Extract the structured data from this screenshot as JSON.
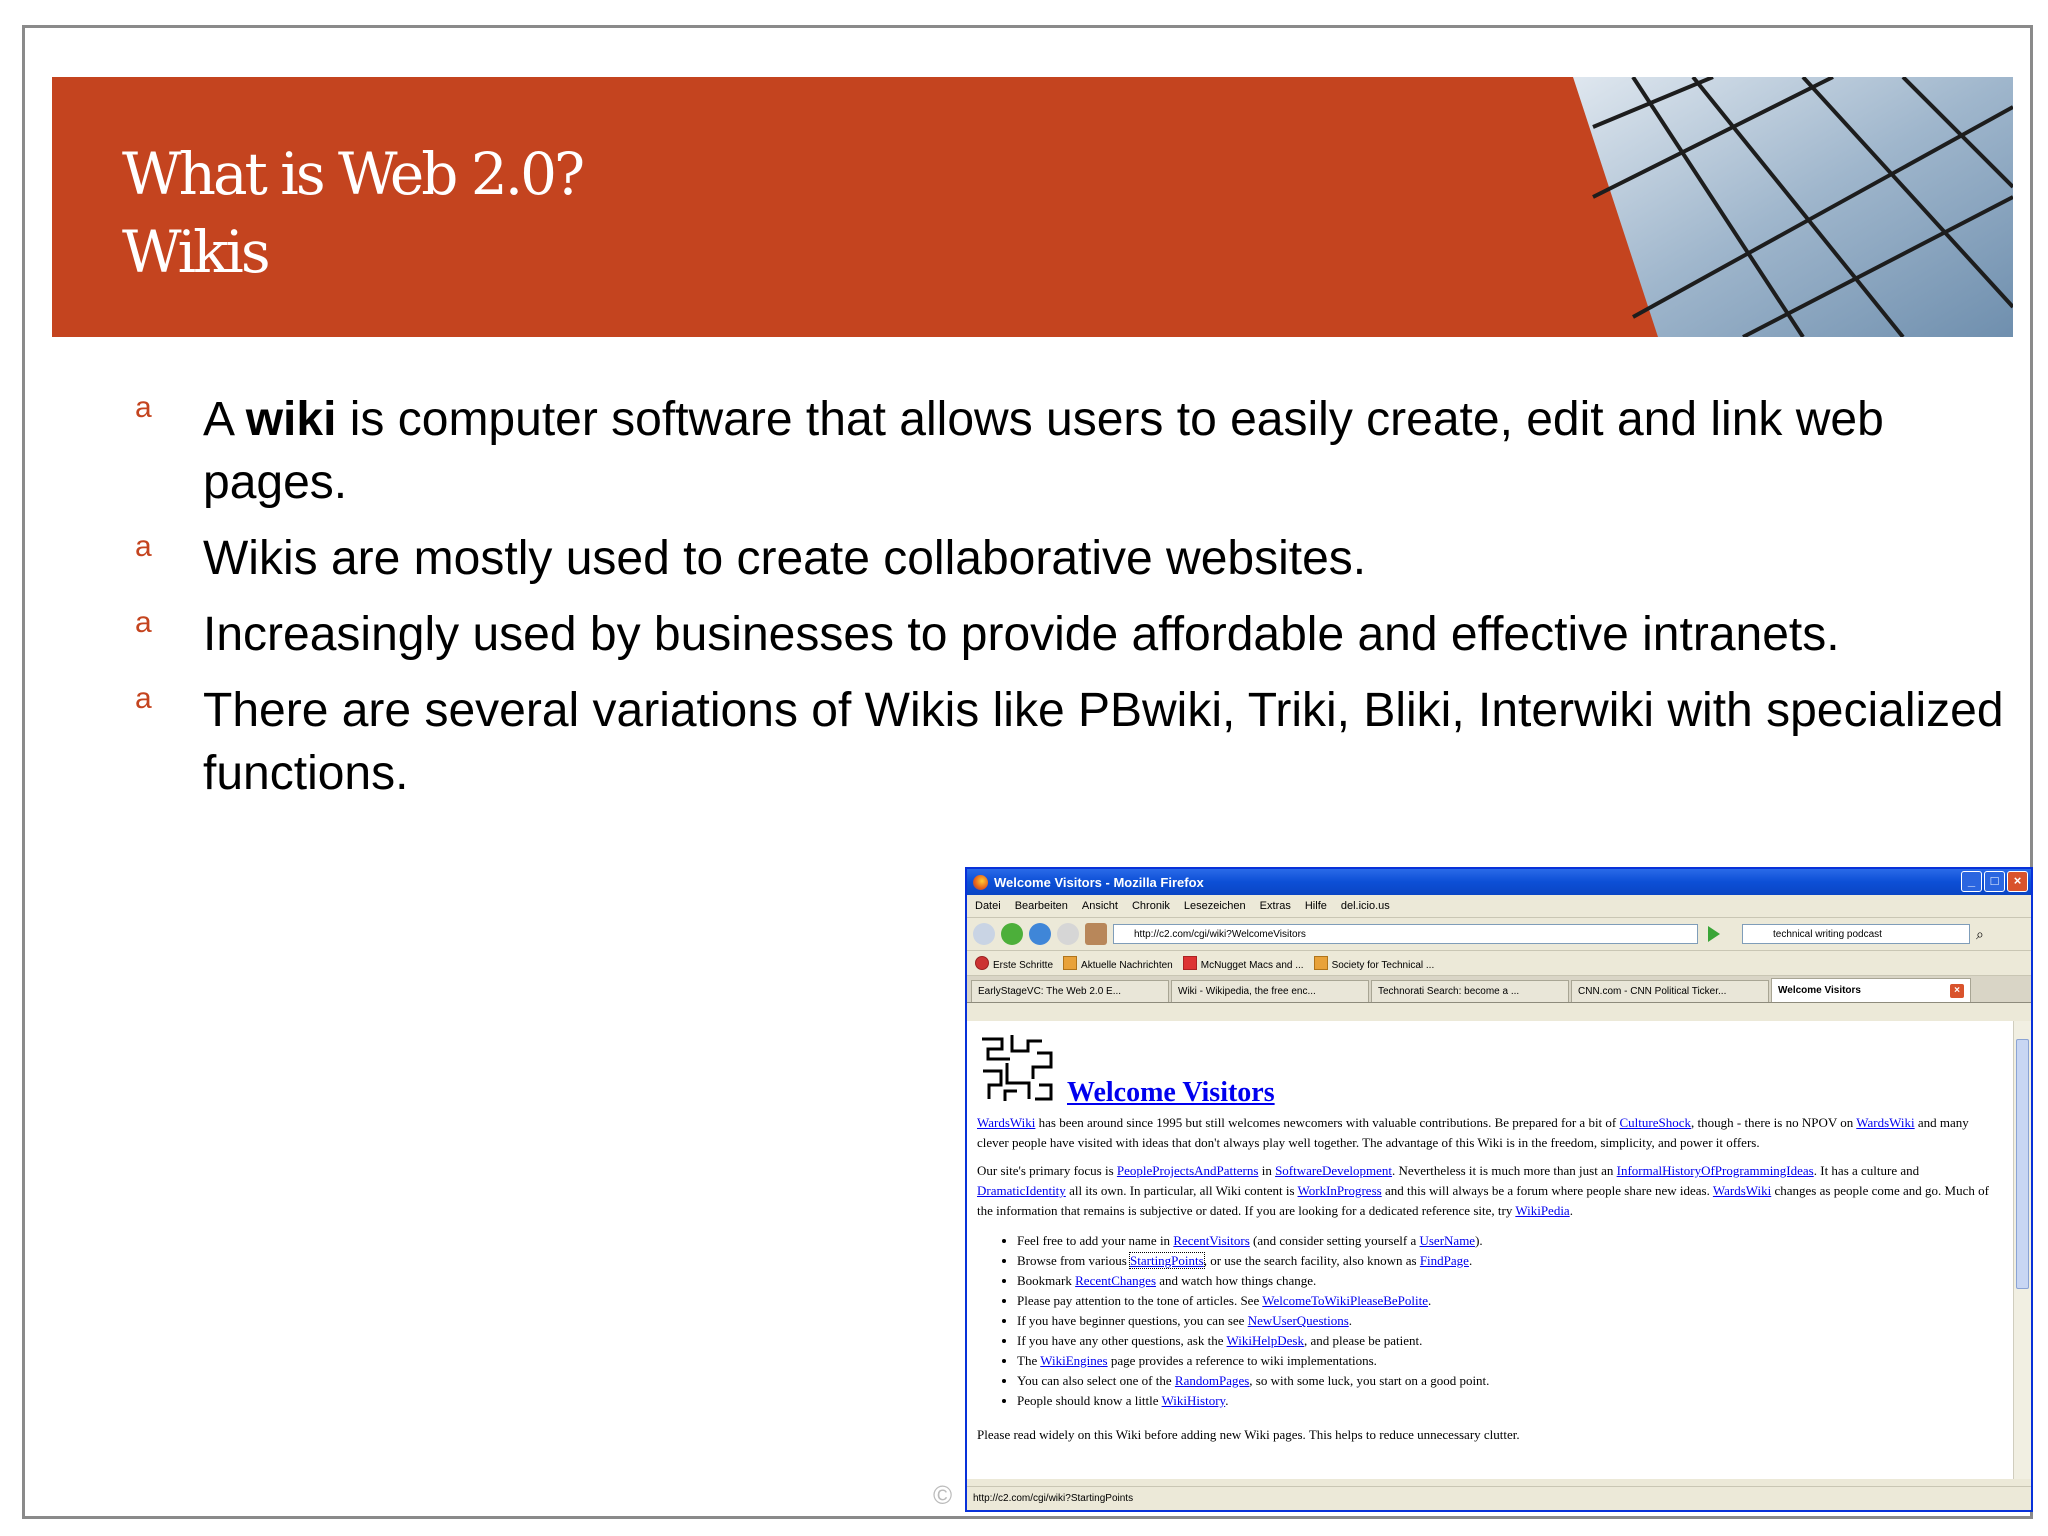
{
  "slide": {
    "title_line1": "What is Web 2.0?",
    "title_line2": "Wikis",
    "accent_color": "#c4441f",
    "bullet_marker": "a",
    "bullets": [
      {
        "pre": "A ",
        "bold": "wiki",
        "post": " is computer software that allows users to easily create, edit and link web pages."
      },
      {
        "pre": "Wikis are mostly used to create collaborative websites.",
        "bold": "",
        "post": ""
      },
      {
        "pre": "Increasingly used  by businesses to provide affordable and effective intranets.",
        "bold": "",
        "post": ""
      },
      {
        "pre": "There are several variations of Wikis like PBwiki, Triki, Bliki, Interwiki with specialized functions.",
        "bold": "",
        "post": ""
      }
    ],
    "copyright": "©"
  },
  "browser": {
    "window_title": "Welcome Visitors - Mozilla Firefox",
    "menu": [
      "Datei",
      "Bearbeiten",
      "Ansicht",
      "Chronik",
      "Lesezeichen",
      "Extras",
      "Hilfe",
      "del.icio.us"
    ],
    "url": "http://c2.com/cgi/wiki?WelcomeVisitors",
    "search_value": "technical writing podcast",
    "bookmarks": [
      "Erste Schritte",
      "Aktuelle Nachrichten",
      "McNugget Macs and ...",
      "Society for Technical ..."
    ],
    "tabs": [
      "EarlyStageVC: The Web 2.0 E...",
      "Wiki - Wikipedia, the free enc...",
      "Technorati Search: become a ...",
      "CNN.com - CNN Political Ticker...",
      "Welcome Visitors"
    ],
    "status": "http://c2.com/cgi/wiki?StartingPoints"
  },
  "wiki": {
    "heading": "Welcome Visitors",
    "p1": {
      "a": "WardsWiki",
      "b": " has been around since 1995 but still welcomes newcomers with valuable contributions. Be prepared for a bit of ",
      "c": "CultureShock",
      "d": ", though - there is no NPOV on ",
      "e": "WardsWiki",
      "f": " and many clever people have visited with ideas that don't always play well together. The advantage of this Wiki is in the freedom, simplicity, and power it offers."
    },
    "p2": {
      "a": "Our site's primary focus is ",
      "b": "PeopleProjectsAndPatterns",
      "c": " in ",
      "d": "SoftwareDevelopment",
      "e": ". Nevertheless it is much more than just an ",
      "f": "InformalHistoryOfProgrammingIdeas",
      "g": ". It has a culture and ",
      "h": "DramaticIdentity",
      "i": " all its own. In particular, all Wiki content is ",
      "j": "WorkInProgress",
      "k": " and this will always be a forum where people share new ideas. ",
      "l": "WardsWiki",
      "m": " changes as people come and go. Much of the information that remains is subjective or dated. If you are looking for a dedicated reference site, try ",
      "n": "WikiPedia",
      "o": "."
    },
    "list": [
      {
        "a": "Feel free to add your name in ",
        "b": "RecentVisitors",
        "c": " (and consider setting yourself a ",
        "d": "UserName",
        "e": ")."
      },
      {
        "a": "Browse from various ",
        "b": "StartingPoints",
        "c": ", or use the search facility, also known as ",
        "d": "FindPage",
        "e": "."
      },
      {
        "a": "Bookmark ",
        "b": "RecentChanges",
        "c": " and watch how things change.",
        "d": "",
        "e": ""
      },
      {
        "a": "Please pay attention to the tone of articles. See ",
        "b": "WelcomeToWikiPleaseBePolite",
        "c": ".",
        "d": "",
        "e": ""
      },
      {
        "a": "If you have beginner questions, you can see ",
        "b": "NewUserQuestions",
        "c": ".",
        "d": "",
        "e": ""
      },
      {
        "a": "If you have any other questions, ask the ",
        "b": "WikiHelpDesk",
        "c": ", and please be patient.",
        "d": "",
        "e": ""
      },
      {
        "a": "The ",
        "b": "WikiEngines",
        "c": " page provides a reference to wiki implementations.",
        "d": "",
        "e": ""
      },
      {
        "a": "You can also select one of the ",
        "b": "RandomPages",
        "c": ", so with some luck, you start on a good point.",
        "d": "",
        "e": ""
      },
      {
        "a": "People should know a little ",
        "b": "WikiHistory",
        "c": ".",
        "d": "",
        "e": ""
      }
    ],
    "footer": "Please read widely on this Wiki before adding new Wiki pages. This helps to reduce unnecessary clutter."
  }
}
